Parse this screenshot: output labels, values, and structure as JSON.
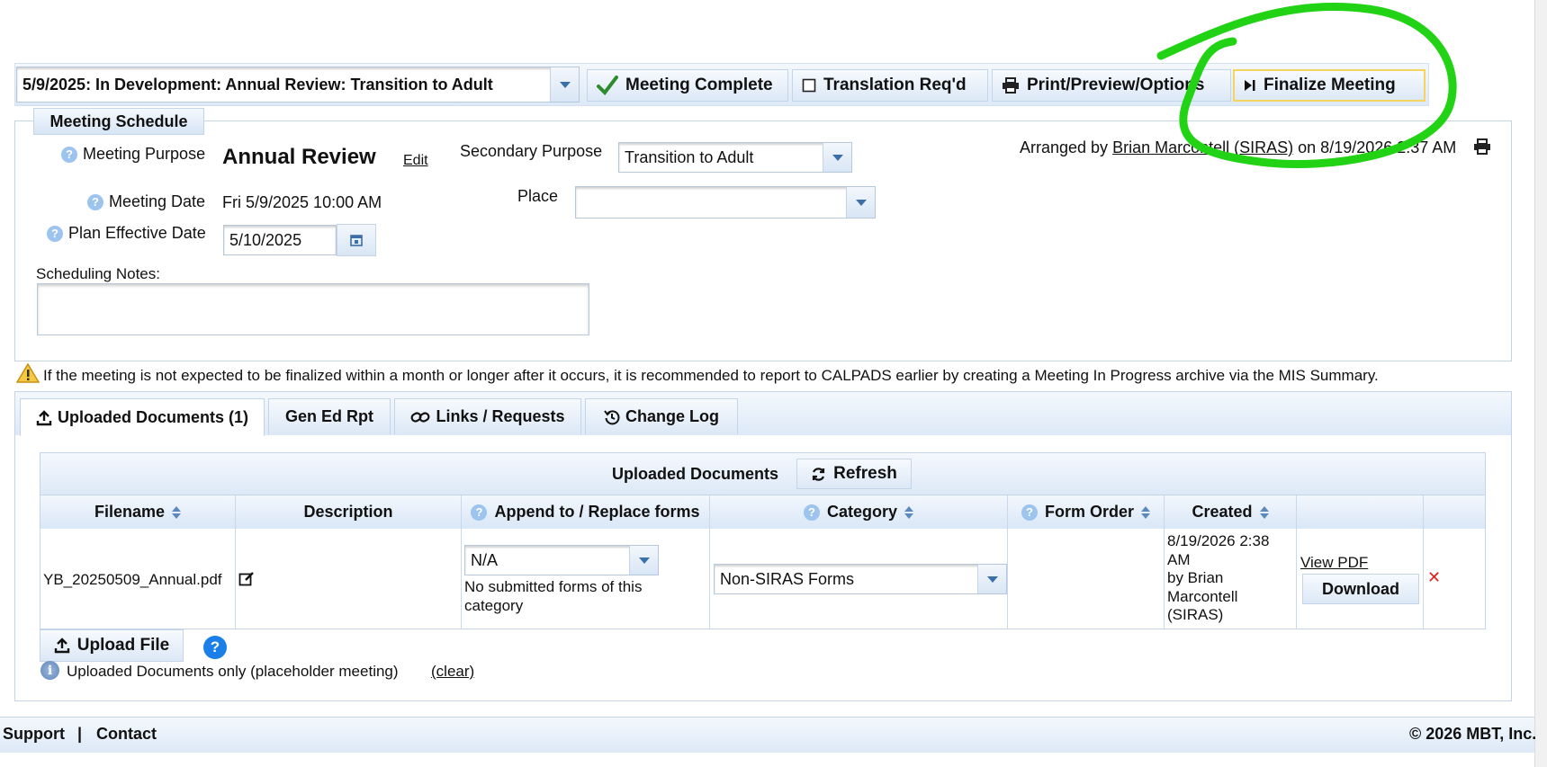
{
  "toolbar": {
    "meeting_select": "5/9/2025: In Development: Annual Review: Transition to Adult",
    "meeting_complete": "Meeting Complete",
    "translation": "Translation Req'd",
    "print_preview": "Print/Preview/Options",
    "finalize": "Finalize Meeting"
  },
  "schedule": {
    "legend": "Meeting Schedule",
    "purpose_label": "Meeting Purpose",
    "purpose_value": "Annual Review",
    "edit_link": "Edit",
    "secondary_label": "Secondary Purpose",
    "secondary_value": "Transition to Adult",
    "date_label": "Meeting Date",
    "date_value": "Fri 5/9/2025 10:00 AM",
    "place_label": "Place",
    "place_value": "",
    "effective_label": "Plan Effective Date",
    "effective_value": "5/10/2025",
    "notes_label": "Scheduling Notes:",
    "notes_value": "",
    "arranged_prefix": "Arranged by",
    "arranged_by": "Brian Marcontell (SIRAS)",
    "arranged_suffix": "on 8/19/2026 2:37 AM"
  },
  "warning_text": "If the meeting is not expected to be finalized within a month or longer after it occurs, it is recommended to report to CALPADS earlier by creating a Meeting In Progress archive via the MIS Summary.",
  "tabs": [
    {
      "label": "Uploaded Documents (1)",
      "icon": "upload-icon"
    },
    {
      "label": "Gen Ed Rpt",
      "icon": ""
    },
    {
      "label": "Links / Requests",
      "icon": "link-icon"
    },
    {
      "label": "Change Log",
      "icon": "history-icon"
    }
  ],
  "documents": {
    "title": "Uploaded Documents",
    "refresh": "Refresh",
    "columns": [
      "Filename",
      "Description",
      "Append to / Replace forms",
      "Category",
      "Form Order",
      "Created"
    ],
    "rows": [
      {
        "filename": "YB_20250509_Annual.pdf",
        "append_value": "N/A",
        "append_note": "No submitted forms of this category",
        "category": "Non-SIRAS Forms",
        "form_order": "",
        "created_1": "8/19/2026 2:38",
        "created_2": "AM",
        "created_3": "by Brian",
        "created_4": "Marcontell",
        "created_5": "(SIRAS)",
        "view_pdf": "View PDF",
        "download": "Download",
        "delete": "✕"
      }
    ],
    "upload": "Upload File",
    "filter_note": "Uploaded Documents only (placeholder meeting)",
    "clear": "(clear)"
  },
  "footer": {
    "support": "Support",
    "separator": "|",
    "contact": "Contact",
    "copyright": "© 2026 MBT, Inc."
  },
  "colors": {
    "accent": "#3b6fa8",
    "highlight_circle": "#22d315",
    "finalize_border": "#f4d35e",
    "delete_red": "#e0201f"
  }
}
